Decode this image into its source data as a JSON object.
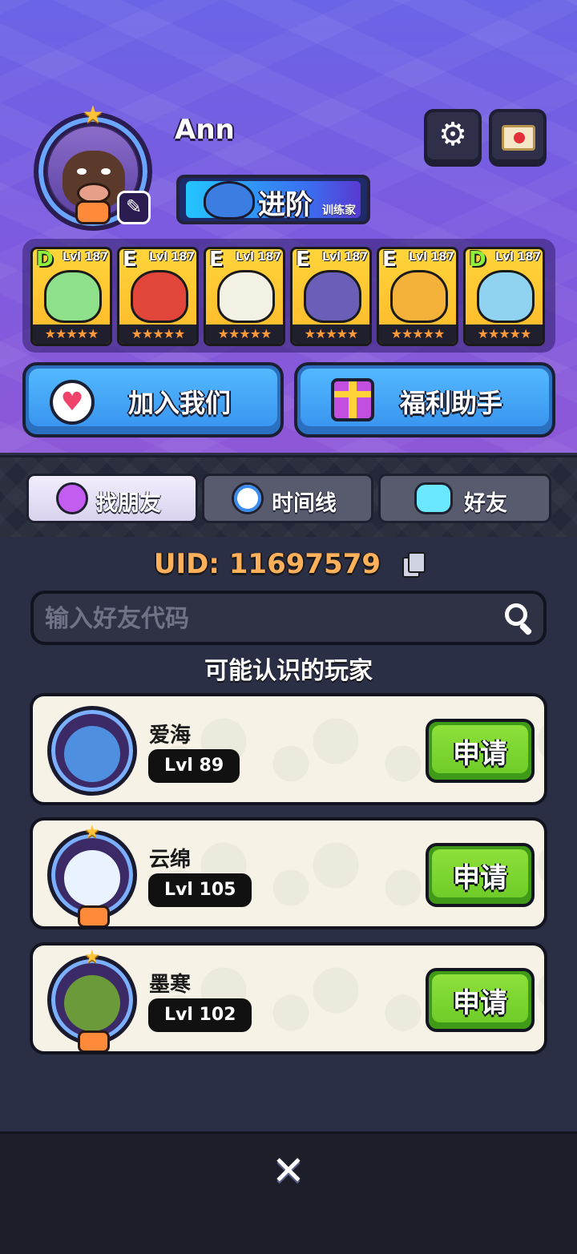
{
  "profile": {
    "name": "Ann",
    "rank_title": "进阶",
    "rank_subtitle": "训练家"
  },
  "team": [
    {
      "grade": "D",
      "level": "Lvl 187",
      "stars": "★★★★★",
      "color": "#8fe08a"
    },
    {
      "grade": "E",
      "level": "Lvl 187",
      "stars": "★★★★★",
      "color": "#e2453a"
    },
    {
      "grade": "E",
      "level": "Lvl 187",
      "stars": "★★★★★",
      "color": "#f3f0e4"
    },
    {
      "grade": "E",
      "level": "Lvl 187",
      "stars": "★★★★★",
      "color": "#6a5fb8"
    },
    {
      "grade": "E",
      "level": "Lvl 187",
      "stars": "★★★★★",
      "color": "#f4b23a"
    },
    {
      "grade": "D",
      "level": "Lvl 187",
      "stars": "★★★★★",
      "color": "#8fd3f0"
    }
  ],
  "actions": {
    "join_label": "加入我们",
    "welfare_label": "福利助手"
  },
  "tabs": [
    {
      "label": "找朋友",
      "active": true
    },
    {
      "label": "时间线",
      "active": false
    },
    {
      "label": "好友",
      "active": false
    }
  ],
  "uid_text": "UID: 11697579",
  "search": {
    "placeholder": "输入好友代码"
  },
  "section_title": "可能认识的玩家",
  "players": [
    {
      "name": "爱海",
      "level": "Lvl 89",
      "avatar_color": "#4f8fe0"
    },
    {
      "name": "云绵",
      "level": "Lvl 105",
      "avatar_color": "#e9f3ff"
    },
    {
      "name": "墨寒",
      "level": "Lvl 102",
      "avatar_color": "#6b9a3a"
    }
  ],
  "apply_label": "申请",
  "close_icon": "close-icon",
  "colors": {
    "accent_orange": "#ffb05a",
    "apply_green": "#7bd42f",
    "action_blue": "#3a96ef"
  }
}
